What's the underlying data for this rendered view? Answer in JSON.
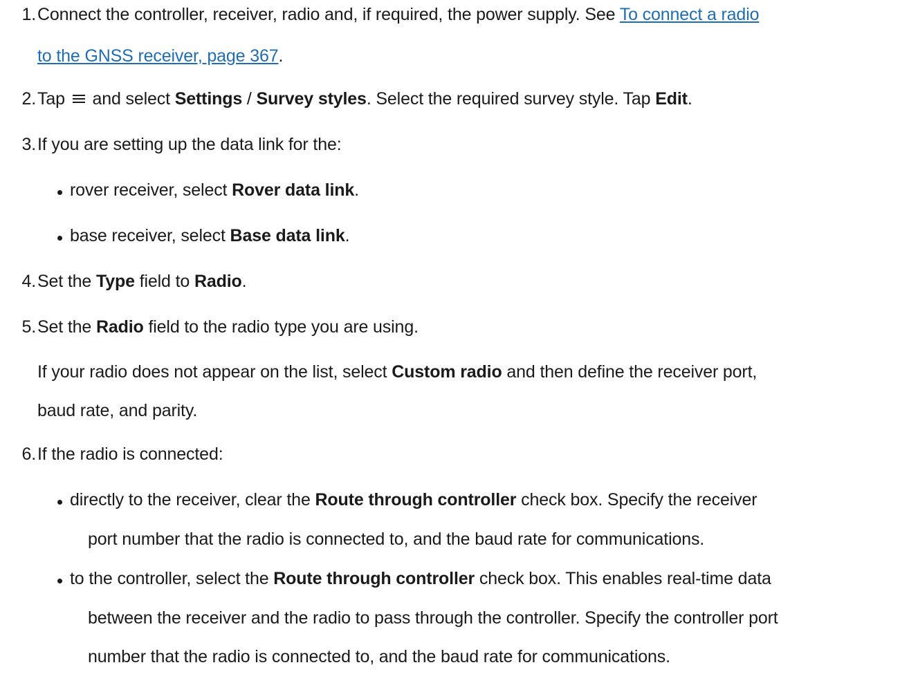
{
  "steps": [
    {
      "number": "1.",
      "line1_text": "Connect the controller, receiver, radio and, if required, the power supply. See ",
      "link_part1": "To connect a radio ",
      "link_part2": "to the GNSS receiver, page 367",
      "line2_end": "."
    },
    {
      "number": "2.",
      "t1": "Tap ",
      "icon": "hamburger-menu-icon",
      "t2": " and select ",
      "b1": "Settings",
      "t3": " / ",
      "b2": "Survey styles",
      "t4": ". Select the required survey style. Tap ",
      "b3": "Edit",
      "t5": "."
    },
    {
      "number": "3.",
      "text": "If you are setting up the data link for the:",
      "bullets": [
        {
          "pre": "rover receiver, select ",
          "bold": "Rover data link",
          "post": "."
        },
        {
          "pre": "base receiver, select ",
          "bold": "Base data link",
          "post": "."
        }
      ]
    },
    {
      "number": "4.",
      "t1": "Set the ",
      "b1": "Type",
      "t2": " field to ",
      "b2": "Radio",
      "t3": "."
    },
    {
      "number": "5.",
      "t1": "Set the ",
      "b1": "Radio",
      "t2": " field to the radio type you are using.",
      "para_t1": "If your radio does not appear on the list, select ",
      "para_b1": "Custom radio",
      "para_t2": " and then define the receiver port,",
      "para_line2": "baud rate, and parity."
    },
    {
      "number": "6.",
      "text": "If the radio is connected:",
      "bullets": [
        {
          "pre": "directly to the receiver, clear the ",
          "bold": "Route through controller",
          "post": " check box. Specify the receiver",
          "line2": "port number that the radio is connected to, and the baud rate for communications."
        },
        {
          "pre": "to the controller, select the ",
          "bold": "Route through controller",
          "post": " check box. This enables real-time data",
          "line2": "between the receiver and the radio to pass through the controller. Specify the controller port",
          "line3": "number that the radio is connected to, and the baud rate for communications."
        }
      ]
    }
  ]
}
